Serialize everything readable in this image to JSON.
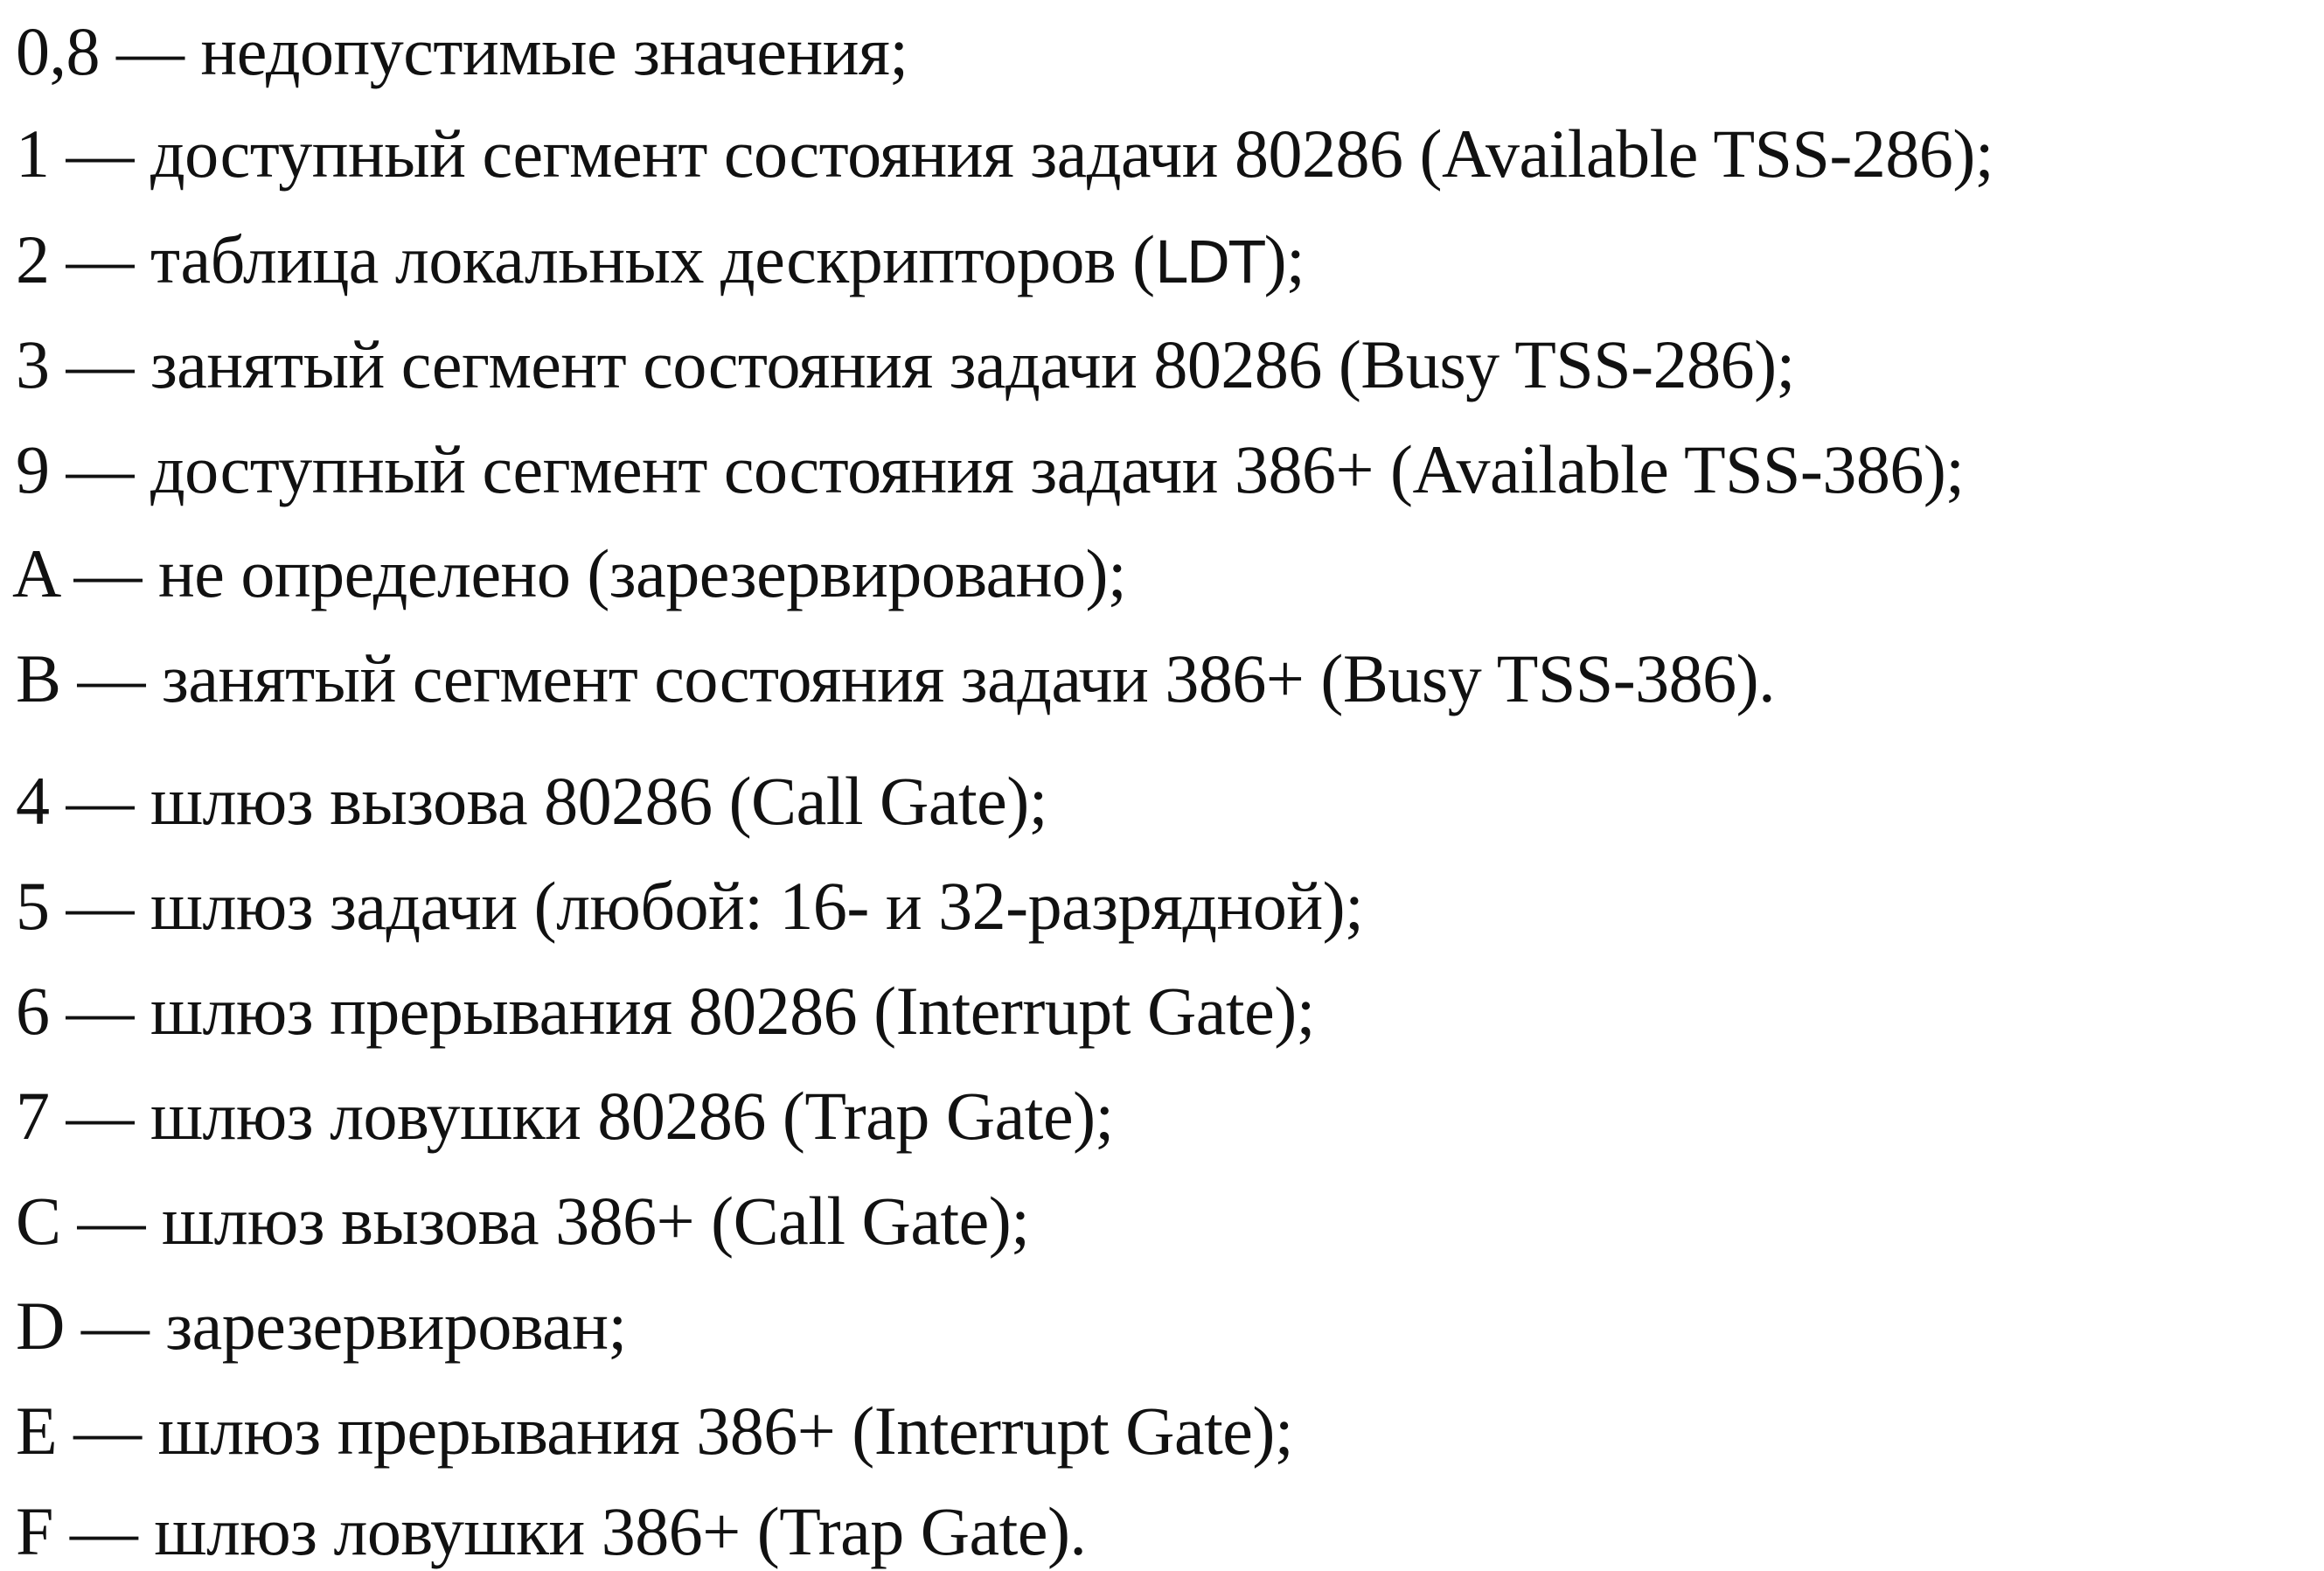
{
  "groups": [
    {
      "lines": [
        {
          "code": "0,8",
          "text": "недопустимые значения;"
        },
        {
          "code": "1",
          "text": "доступный сегмент состояния задачи 80286 (Available TSS-286);"
        },
        {
          "code": "2",
          "text_before": "таблица локальных дескрипторов (",
          "abbr": "LDT",
          "text_after": ");"
        },
        {
          "code": "3",
          "text": "занятый сегмент состояния задачи 80286 (Busy TSS-286);"
        },
        {
          "code": "9",
          "text": "доступный сегмент состояния задачи 386+ (Available TSS-386);"
        },
        {
          "code": "A",
          "text": "не определено (зарезервировано);"
        },
        {
          "code": "B",
          "text": "занятый сегмент состояния задачи 386+ (Busy TSS-386)."
        }
      ]
    },
    {
      "lines": [
        {
          "code": "4",
          "text": "шлюз вызова 80286 (Call Gate);"
        },
        {
          "code": "5",
          "text": "шлюз задачи (любой: 16- и 32-разрядной);"
        },
        {
          "code": "6",
          "text": "шлюз прерывания 80286 (Interrupt Gate);"
        },
        {
          "code": "7",
          "text": "шлюз ловушки 80286 (Trap Gate);"
        },
        {
          "code": "C",
          "text": "шлюз вызова 386+ (Call Gate);"
        },
        {
          "code": "D",
          "text": "зарезервирован;"
        },
        {
          "code": "E",
          "text": "шлюз прерывания 386+ (Interrupt Gate);"
        },
        {
          "code": "F",
          "text": "шлюз ловушки 386+ (Trap Gate)."
        }
      ]
    }
  ],
  "separator": " — "
}
